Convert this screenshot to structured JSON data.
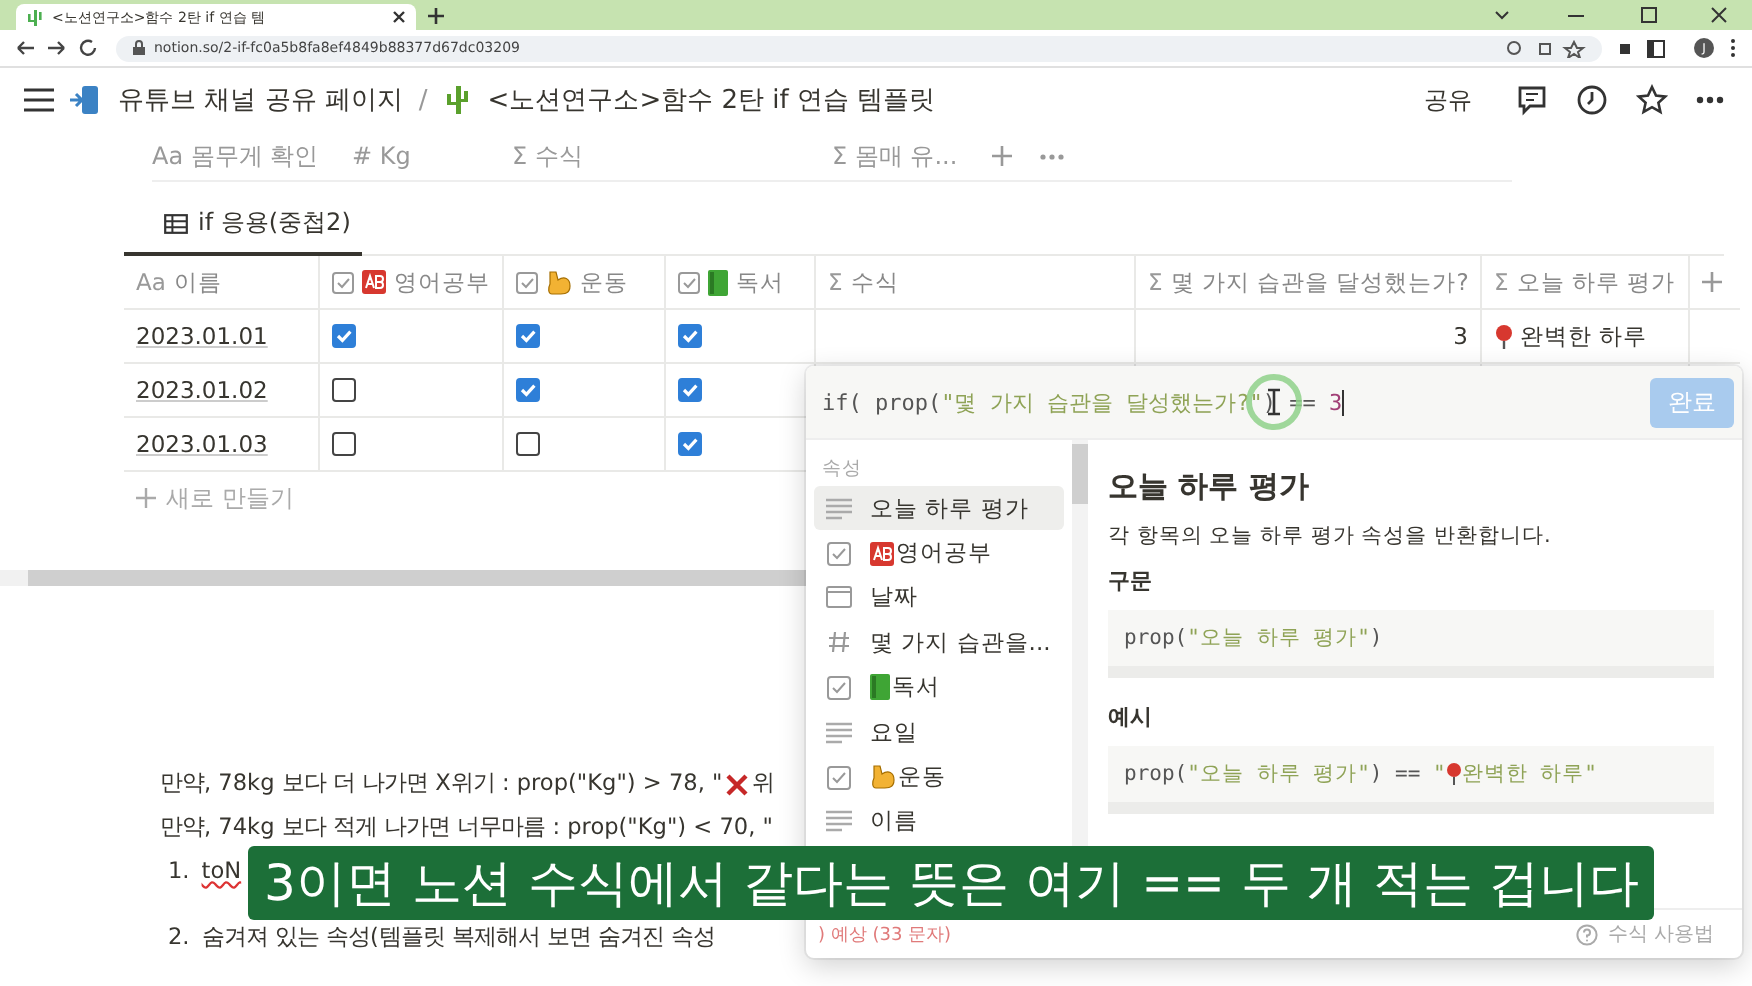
{
  "browser": {
    "tab_title": "<노션연구소>함수 2탄 if 연습 템",
    "url": "notion.so/2-if-fc0a5b8fa8ef4849b88377d67dc03209",
    "profile": "J"
  },
  "breadcrumbs": [
    {
      "label": "유튜브 채널 공유 페이지"
    },
    {
      "label": "<노션연구소>함수 2탄 if 연습 템플릿"
    }
  ],
  "breadcrumb_separator": "/",
  "share": "공유",
  "upper_columns": [
    {
      "prefix": "Aa",
      "label": "몸무게 확인"
    },
    {
      "prefix": "#",
      "label": "Kg"
    },
    {
      "prefix": "Σ",
      "label": "수식"
    },
    {
      "prefix": "Σ",
      "label": "몸매 유..."
    }
  ],
  "view_tab": {
    "label": "if 응용(중첩2)",
    "selected": true
  },
  "table": {
    "columns": [
      {
        "kind": "title",
        "prefix": "Aa",
        "label": "이름"
      },
      {
        "kind": "checkbox",
        "label": "영어공부"
      },
      {
        "kind": "checkbox",
        "label": "운동"
      },
      {
        "kind": "checkbox",
        "label": "독서"
      },
      {
        "kind": "formula",
        "prefix": "Σ",
        "label": "수식"
      },
      {
        "kind": "formula",
        "prefix": "Σ",
        "label": "몇 가지 습관을 달성했는가?"
      },
      {
        "kind": "formula",
        "prefix": "Σ",
        "label": "오늘 하루 평가"
      }
    ],
    "rows": [
      {
        "name": "2023.01.01",
        "checks": [
          {
            "checked": true
          },
          {
            "checked": true
          },
          {
            "checked": true
          }
        ],
        "count": "3",
        "rating": "완벽한 하루"
      },
      {
        "name": "2023.01.02",
        "checks": [
          {
            "checked": false
          },
          {
            "checked": true
          },
          {
            "checked": true
          }
        ]
      },
      {
        "name": "2023.01.03",
        "checks": [
          {
            "checked": false
          },
          {
            "checked": false
          },
          {
            "checked": true
          }
        ]
      }
    ],
    "new_row": "새로 만들기"
  },
  "body": {
    "lines": [
      {
        "before": "만약, 78kg 보다 더 나가면 X위기 : prop(\"Kg\") > 78, \"",
        "after": "위"
      },
      {
        "before": "만약, 74kg 보다 적게 나가면 너무마름 : prop(\"Kg\") < 70, \""
      }
    ],
    "list": [
      {
        "num": "1.",
        "text": "toN"
      },
      {
        "num": "2.",
        "text": "숨겨져 있는 속성(템플릿 복제해서 보면 숨겨진 속성"
      }
    ]
  },
  "popup": {
    "formula": [
      {
        "kind": "code",
        "text": "if( prop("
      },
      {
        "kind": "string",
        "text": "\"몇 가지 습관을 달성했는가?\""
      },
      {
        "kind": "code",
        "text": ") == "
      },
      {
        "kind": "number",
        "text": "3"
      }
    ],
    "done": {
      "label": "완료",
      "disabled": true
    },
    "section": "속성",
    "items": [
      {
        "kind": "text",
        "label": "오늘 하루 평가",
        "selected": true
      },
      {
        "kind": "checkbox",
        "label": "영어공부",
        "selected": false
      },
      {
        "kind": "date",
        "label": "날짜",
        "selected": false
      },
      {
        "kind": "number",
        "label": "몇 가지 습관을...",
        "selected": false
      },
      {
        "kind": "checkbox",
        "label": "독서",
        "selected": false
      },
      {
        "kind": "text",
        "label": "요일",
        "selected": false
      },
      {
        "kind": "checkbox",
        "label": "운동",
        "selected": false
      },
      {
        "kind": "text",
        "label": "이름",
        "selected": false
      }
    ],
    "title": "오늘 하루 평가",
    "description": "각 항목의 오늘 하루 평가 속성을 반환합니다.",
    "syntax_heading": "구문",
    "syntax": [
      {
        "kind": "code",
        "text": "prop("
      },
      {
        "kind": "string",
        "text": "\"오늘 하루 평가\""
      },
      {
        "kind": "code",
        "text": ")"
      }
    ],
    "example_heading": "예시",
    "example": [
      {
        "kind": "code",
        "text": "prop("
      },
      {
        "kind": "string",
        "text": "\"오늘 하루 평가\""
      },
      {
        "kind": "code",
        "text": ") == "
      },
      {
        "kind": "string",
        "text": "\""
      },
      {
        "kind": "pin"
      },
      {
        "kind": "string",
        "text": "완벽한 하루\""
      }
    ],
    "error": ") 예상 (33 문자)",
    "help": "수식 사용법"
  },
  "subtitle": "3이면 노션 수식에서 같다는 뜻은 여기 == 두 개 적는 겁니다"
}
